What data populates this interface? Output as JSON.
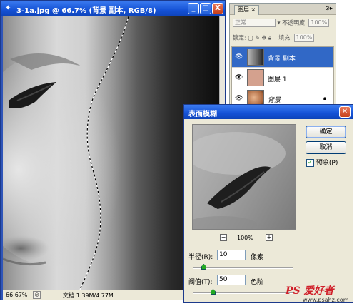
{
  "document": {
    "title": "3-1a.jpg @ 66.7% (背景 副本, RGB/8)",
    "window_buttons": {
      "minimize": "_",
      "maximize": "□",
      "close": "X"
    },
    "status": {
      "zoom": "66.67%",
      "doc_info": "文档:1.39M/4.77M"
    }
  },
  "layers_panel": {
    "tab": "图层",
    "tab_close": "×",
    "blend_mode": "正常",
    "opacity_label": "不透明度:",
    "opacity_value": "100%",
    "lock_label": "锁定:",
    "fill_label": "填充:",
    "fill_value": "100%",
    "layers": [
      {
        "name": "背景 副本",
        "selected": true,
        "locked": false
      },
      {
        "name": "图层 1",
        "selected": false,
        "locked": false
      },
      {
        "name": "背景",
        "selected": false,
        "locked": true
      }
    ]
  },
  "dialog": {
    "title": "表面模糊",
    "ok_label": "确定",
    "cancel_label": "取消",
    "preview_label": "预览(P)",
    "preview_checked": true,
    "zoom_value": "100%",
    "radius": {
      "label": "半径(R):",
      "value": "10",
      "unit": "像素",
      "fraction": 0.07
    },
    "threshold": {
      "label": "阈值(T):",
      "value": "50",
      "unit": "色阶",
      "fraction": 0.2
    }
  },
  "watermark": {
    "logo": "PS 爱好者",
    "url": "www.psahz.com"
  },
  "colors": {
    "titlebar": "#1552d6",
    "selected_layer": "#3168c6",
    "dialog_bg": "#ece9d8"
  }
}
